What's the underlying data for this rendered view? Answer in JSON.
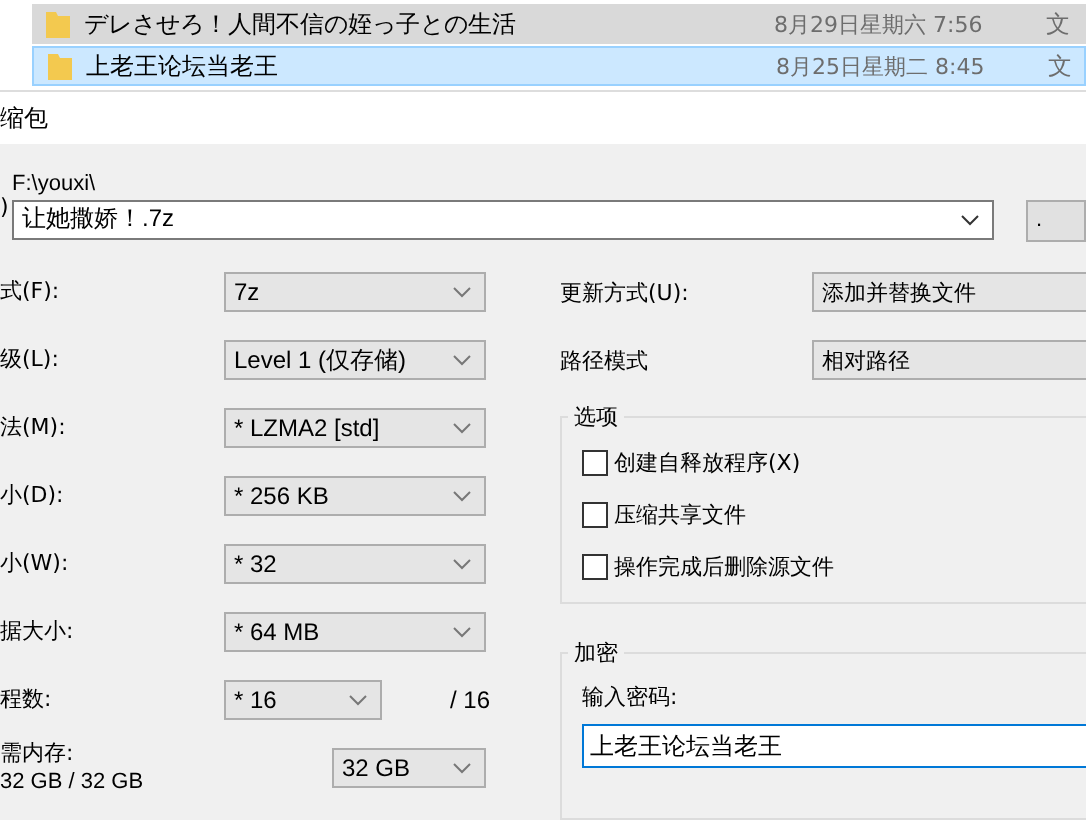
{
  "file_list": [
    {
      "name": "デレさせろ！人間不信の姪っ子との生活",
      "date": "8月29日星期六 7:56",
      "type": "文",
      "selected": false
    },
    {
      "name": "上老王论坛当老王",
      "date": "8月25日星期二 8:45",
      "type": "文",
      "selected": true
    }
  ],
  "dialog": {
    "title": "缩包",
    "archive": {
      "label": ")",
      "folder": "F:\\youxi\\",
      "value": "让她撒娇！.7z",
      "browse": "."
    },
    "left": [
      {
        "label": "式(F):",
        "value": "7z",
        "kind": "wide"
      },
      {
        "label": "级(L):",
        "value": "Level 1 (仅存储)",
        "kind": "wide"
      },
      {
        "label": "法(M):",
        "value": "* LZMA2 [std]",
        "kind": "wide"
      },
      {
        "label": "小(D):",
        "value": "* 256 KB",
        "kind": "wide"
      },
      {
        "label": "小(W):",
        "value": "* 32",
        "kind": "wide"
      },
      {
        "label": "据大小:",
        "value": "* 64 MB",
        "kind": "wide"
      },
      {
        "label": "程数:",
        "value": "* 16",
        "kind": "threads",
        "suffix": "/ 16"
      },
      {
        "label": "需内存:",
        "sublabel": "32 GB / 32 GB",
        "value": "32 GB",
        "kind": "memory"
      }
    ],
    "update_mode": {
      "label": "更新方式(U):",
      "value": "添加并替换文件"
    },
    "path_mode": {
      "label": "路径模式",
      "value": "相对路径"
    },
    "options": {
      "title": "选项",
      "items": [
        {
          "label": "创建自释放程序(X)",
          "checked": false
        },
        {
          "label": "压缩共享文件",
          "checked": false
        },
        {
          "label": "操作完成后删除源文件",
          "checked": false
        }
      ]
    },
    "encryption": {
      "title": "加密",
      "password_label": "输入密码:",
      "password": "上老王论坛当老王"
    }
  }
}
